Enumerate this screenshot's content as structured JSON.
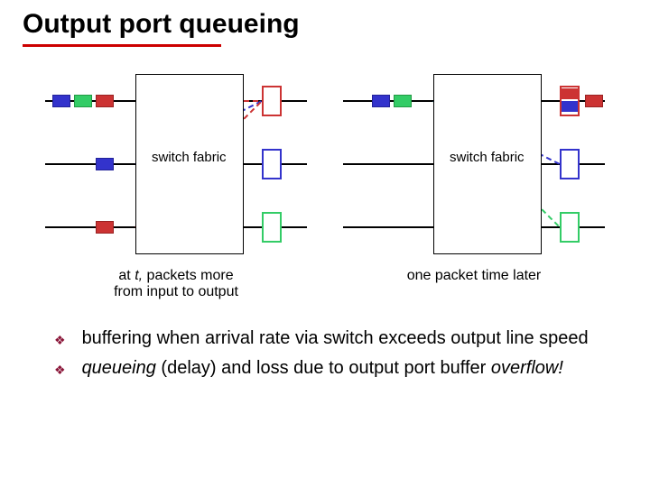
{
  "title": "Output port queueing",
  "diagrams": {
    "left": {
      "fabric_label": "switch\nfabric",
      "caption": "at t, packets more\nfrom input to output"
    },
    "right": {
      "fabric_label": "switch\nfabric",
      "caption": "one packet time later"
    }
  },
  "bullets": [
    "buffering when arrival rate via switch exceeds output line speed",
    "queueing (delay) and loss due to output port buffer overflow!"
  ],
  "italic_words": [
    "queueing",
    "overflow!"
  ],
  "colors": {
    "red": "#c33",
    "blue": "#33c",
    "green": "#3c6",
    "accent": "#8a1538"
  }
}
